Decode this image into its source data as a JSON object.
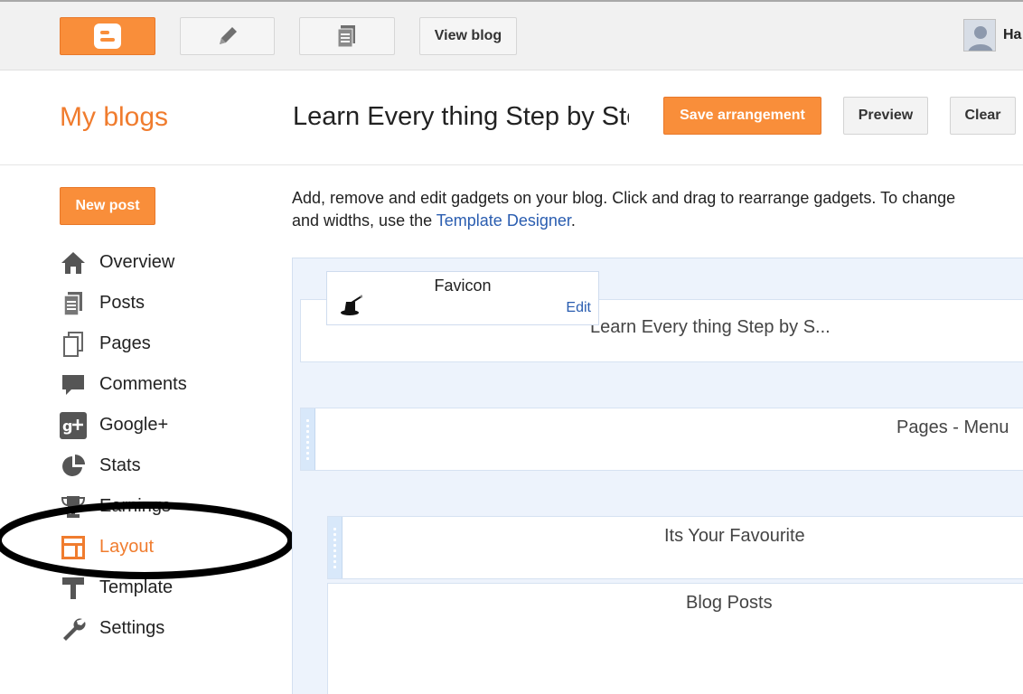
{
  "topbar": {
    "view_blog_label": "View blog",
    "user_name": "Ha",
    "icons": [
      "blogger-logo-icon",
      "pencil-icon",
      "pages-icon"
    ]
  },
  "header": {
    "my_blogs": "My blogs",
    "blog_title": "Learn Every thing Step by Step",
    "save_label": "Save arrangement",
    "preview_label": "Preview",
    "clear_label": "Clear"
  },
  "sidebar": {
    "new_post_label": "New post",
    "items": [
      {
        "label": "Overview",
        "icon": "home-icon"
      },
      {
        "label": "Posts",
        "icon": "posts-icon"
      },
      {
        "label": "Pages",
        "icon": "pages-icon"
      },
      {
        "label": "Comments",
        "icon": "comment-icon"
      },
      {
        "label": "Google+",
        "icon": "google-plus-icon"
      },
      {
        "label": "Stats",
        "icon": "pie-chart-icon"
      },
      {
        "label": "Earnings",
        "icon": "trophy-icon"
      },
      {
        "label": "Layout",
        "icon": "layout-icon",
        "active": true
      },
      {
        "label": "Template",
        "icon": "template-icon"
      },
      {
        "label": "Settings",
        "icon": "wrench-icon"
      }
    ]
  },
  "main": {
    "description_prefix": "Add, remove and edit gadgets on your blog. Click and drag to rearrange gadgets. To change",
    "description_line2": "and widths, use the ",
    "template_designer_link": "Template Designer",
    "description_suffix": ".",
    "gadgets": {
      "header_title": "Learn Every thing Step by S...",
      "favicon_title": "Favicon",
      "favicon_edit": "Edit",
      "pages_menu": "Pages - Menu",
      "its_your_favourite": "Its Your Favourite",
      "blog_posts": "Blog Posts"
    }
  },
  "colors": {
    "accent_orange": "#f98e3a",
    "link_blue": "#2a5db0",
    "layout_canvas": "#edf3fc"
  }
}
